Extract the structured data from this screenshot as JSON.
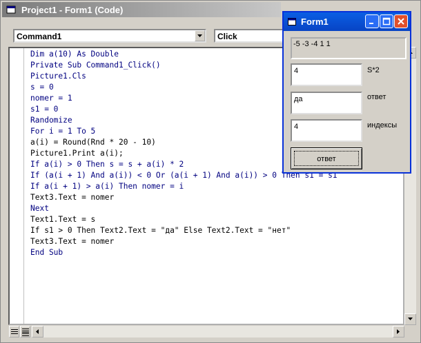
{
  "code_window": {
    "title": "Project1 - Form1 (Code)",
    "object_combo": "Command1",
    "procedure_combo": "Click",
    "code_lines": [
      [
        {
          "t": "Dim a(10) As Double",
          "c": "kw"
        }
      ],
      [
        {
          "t": "Private Sub Command1_Click()",
          "c": "kw"
        }
      ],
      [
        {
          "t": "Picture1.Cls",
          "c": "kw"
        }
      ],
      [
        {
          "t": "s = 0",
          "c": "kw"
        }
      ],
      [
        {
          "t": "nomer = 1",
          "c": "kw"
        }
      ],
      [
        {
          "t": "s1 = 0",
          "c": "kw"
        }
      ],
      [
        {
          "t": "Randomize",
          "c": "kw"
        }
      ],
      [
        {
          "t": "For i = 1 To 5",
          "c": "kw"
        }
      ],
      [
        {
          "t": "a(i) = Round(Rnd * 20 - 10)",
          "c": ""
        }
      ],
      [
        {
          "t": "Picture1.Print a(i);",
          "c": ""
        }
      ],
      [
        {
          "t": "If a(i) > 0 Then s = s + a(i) * 2",
          "c": "kw"
        }
      ],
      [
        {
          "t": "If (a(i + 1) And a(i)) < 0 Or (a(i + 1) And a(i)) > 0 Then s1 = s1",
          "c": "kw"
        }
      ],
      [
        {
          "t": "If a(i + 1) > a(i) Then nomer = i",
          "c": "kw"
        }
      ],
      [
        {
          "t": "Text3.Text = nomer",
          "c": ""
        }
      ],
      [
        {
          "t": "Next",
          "c": "kw"
        }
      ],
      [
        {
          "t": "Text1.Text = s",
          "c": ""
        }
      ],
      [
        {
          "t": "If s1 > 0 Then Text2.Text = \"да\" Else Text2.Text = \"нет\"",
          "c": ""
        }
      ],
      [
        {
          "t": "Text3.Text = nomer",
          "c": ""
        }
      ],
      [
        {
          "t": "End Sub",
          "c": "kw"
        }
      ]
    ]
  },
  "form1": {
    "title": "Form1",
    "picture_output": "-5 -3 -4  1  1",
    "text1": "4",
    "text2": "да",
    "text3": "4",
    "label1": "S*2",
    "label2": "ответ",
    "label3": "индексы",
    "button": "ответ"
  }
}
